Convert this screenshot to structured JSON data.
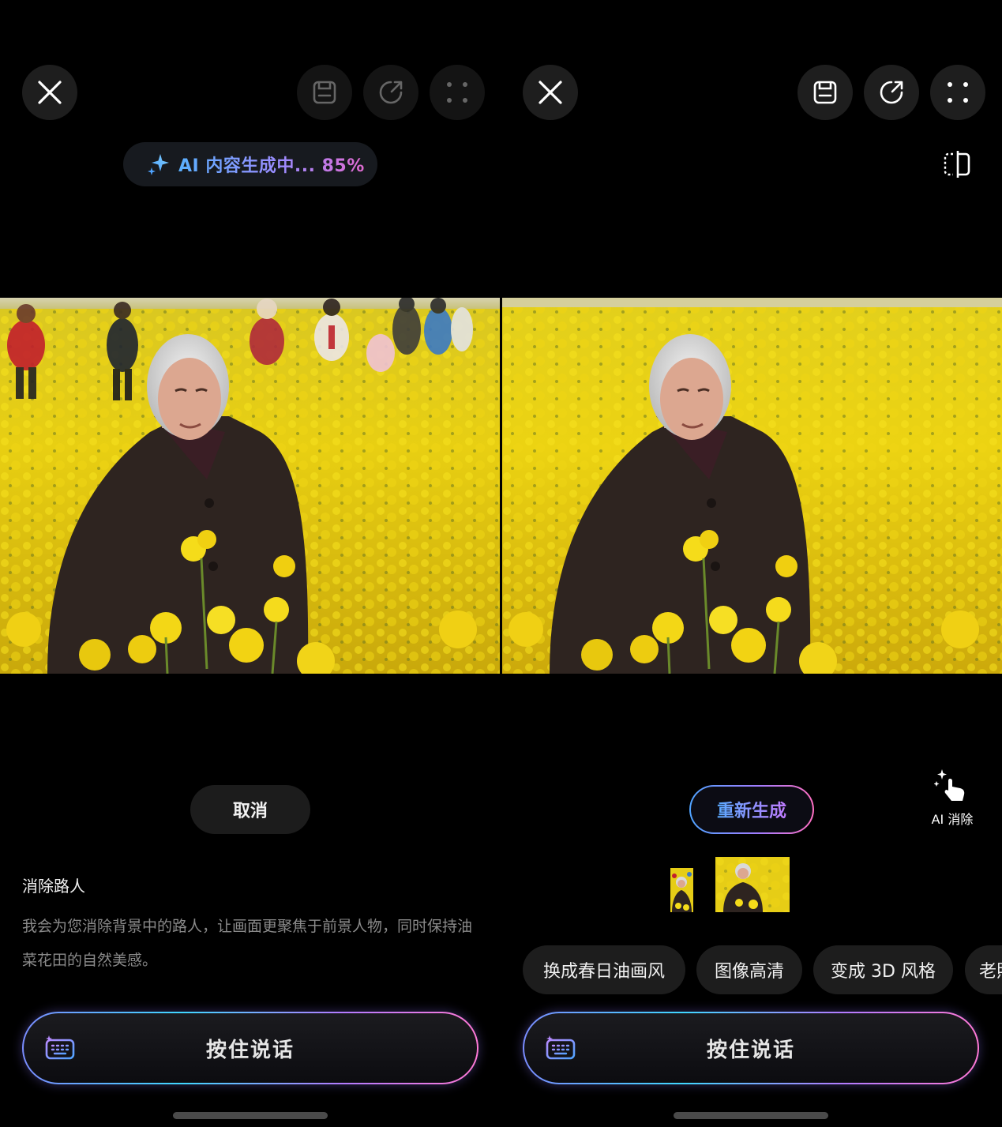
{
  "left_panel": {
    "toolbar": {
      "close_icon": "close-icon",
      "save_icon": "save-icon",
      "share_icon": "share-icon",
      "more_icon": "more-dots-icon"
    },
    "progress_pill": {
      "text": "AI 内容生成中... 85%",
      "icon": "sparkle-icon",
      "progress": 0.85
    },
    "cancel_label": "取消",
    "task_title": "消除路人",
    "task_description": "我会为您消除背景中的路人，让画面更聚焦于前景人物，同时保持油菜花田的自然美感。",
    "voice_button_label": "按住说话"
  },
  "right_panel": {
    "toolbar": {
      "close_icon": "close-icon",
      "save_icon": "save-icon",
      "share_icon": "share-icon",
      "more_icon": "more-dots-icon",
      "compare_icon": "compare-icon"
    },
    "regenerate_label": "重新生成",
    "ai_erase_label": "AI 消除",
    "suggestion_chips": [
      "换成春日油画风",
      "图像高清",
      "变成 3D 风格",
      "老照"
    ],
    "voice_button_label": "按住说话"
  },
  "colors": {
    "background": "#000000",
    "flower_yellow": "#f2d21a",
    "coat": "#2e2420",
    "accent_gradient": [
      "#4fa3ff",
      "#a07cff",
      "#ff6fc1"
    ]
  }
}
